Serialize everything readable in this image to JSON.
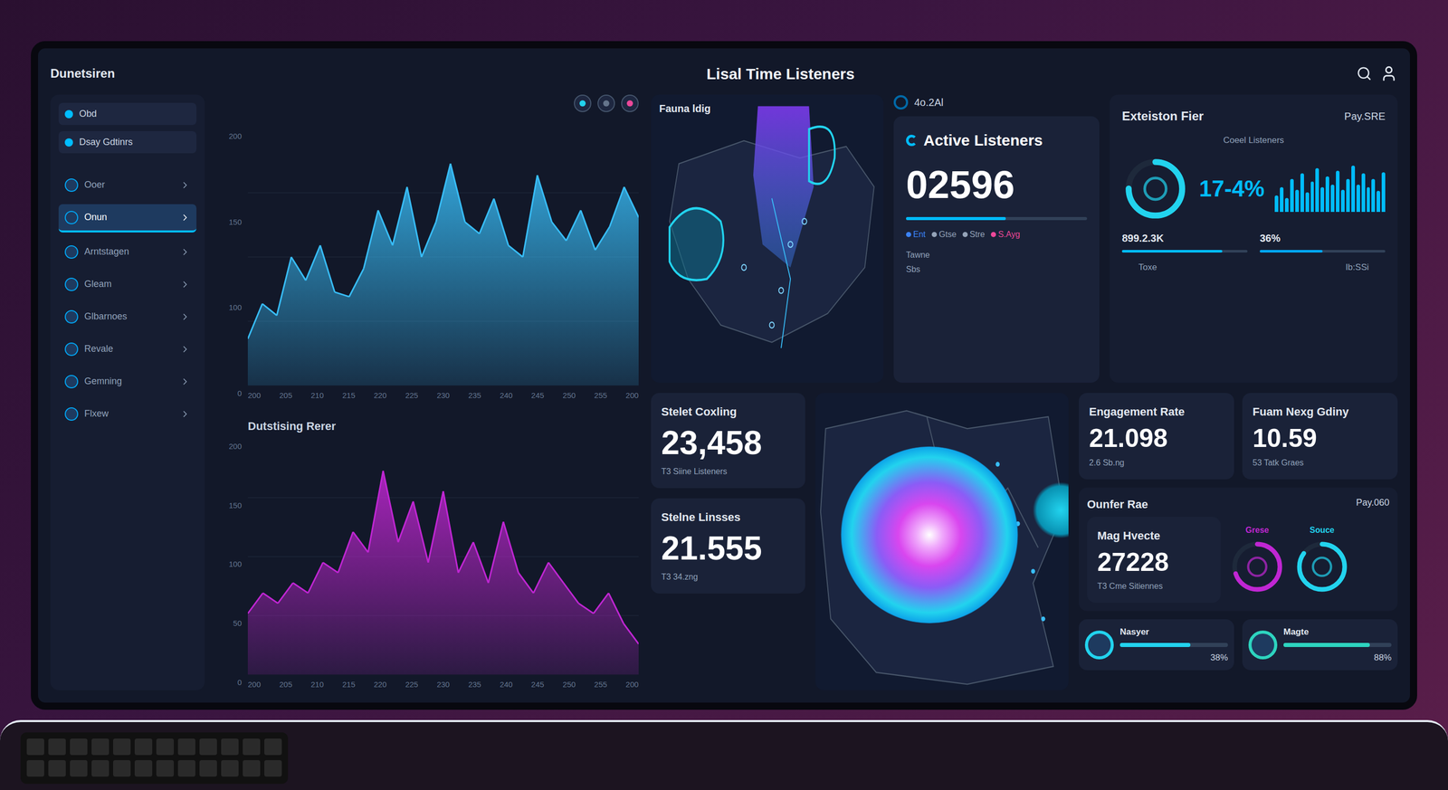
{
  "header": {
    "brand": "Dunetsiren",
    "title": "Lisal Time Listeners"
  },
  "sidebar": {
    "filters": [
      {
        "label": "Obd"
      },
      {
        "label": "Dsay Gdtinrs"
      }
    ],
    "items": [
      {
        "label": "Ooer",
        "selected": false
      },
      {
        "label": "Onun",
        "selected": true
      },
      {
        "label": "Arntstagen",
        "selected": false
      },
      {
        "label": "Gleam",
        "selected": false
      },
      {
        "label": "Glbarnoes",
        "selected": false
      },
      {
        "label": "Revale",
        "selected": false
      },
      {
        "label": "Gemning",
        "selected": false
      },
      {
        "label": "Flxew",
        "selected": false
      }
    ]
  },
  "charts": [
    {
      "title": "",
      "y_ticks": [
        "200",
        "150",
        "100",
        "0"
      ],
      "x_ticks": [
        "200",
        "205",
        "210",
        "215",
        "220",
        "225",
        "230",
        "235",
        "240",
        "245",
        "250",
        "255",
        "200"
      ],
      "values": [
        20,
        35,
        30,
        55,
        45,
        60,
        40,
        38,
        50,
        75,
        60,
        85,
        55,
        70,
        95,
        70,
        65,
        80,
        60,
        55,
        90,
        70,
        62,
        75,
        58,
        68,
        85,
        72
      ],
      "color": "#38bdf8"
    },
    {
      "title": "Dutstising Rerer",
      "y_ticks": [
        "200",
        "150",
        "100",
        "50",
        "0"
      ],
      "x_ticks": [
        "200",
        "205",
        "210",
        "215",
        "220",
        "225",
        "230",
        "235",
        "240",
        "245",
        "250",
        "255",
        "200"
      ],
      "values": [
        30,
        40,
        35,
        45,
        40,
        55,
        50,
        70,
        60,
        100,
        65,
        85,
        55,
        90,
        50,
        65,
        45,
        75,
        50,
        40,
        55,
        45,
        35,
        30,
        40,
        25,
        15
      ],
      "color": "#c026d3"
    }
  ],
  "map_top": {
    "label": "Fauna ldig"
  },
  "active": {
    "badge": "4o.2Al",
    "title": "Active Listeners",
    "value": "02596",
    "level": 0.55,
    "legend": [
      {
        "label": "Ent",
        "color": "#3b82f6"
      },
      {
        "label": "Gtse",
        "color": "#94a3b8"
      },
      {
        "label": "Stre",
        "color": "#94a3b8"
      },
      {
        "label": "S.Ayg",
        "color": "#ec4899"
      }
    ],
    "footer": [
      "Tawne",
      "Sbs"
    ]
  },
  "extension": {
    "title": "Exteiston Fier",
    "badge": "Pay.SRE",
    "subtitle": "Coeel Listeners",
    "percent": "17-4%",
    "ring_level": 0.75,
    "stat": "899.2.3K",
    "stat_level": 0.8,
    "stat2": "36%",
    "stat2_level": 0.5,
    "bars": [
      30,
      45,
      25,
      60,
      40,
      70,
      35,
      55,
      80,
      45,
      65,
      50,
      75,
      40,
      60,
      85,
      50,
      70,
      45,
      60,
      38,
      72
    ],
    "ticks": [
      "Toxe",
      "Ib:SSi"
    ]
  },
  "stat_cards": [
    {
      "title": "Stelet Coxling",
      "value": "23,458",
      "caption": "T3 Siine Listeners"
    },
    {
      "title": "Stelne Linsses",
      "value": "21.555",
      "caption": "T3 34.zng"
    }
  ],
  "kpis": [
    {
      "title": "Engagement Rate",
      "value": "21.098",
      "caption": "2.6 Sb.ng"
    },
    {
      "title": "Fuam Nexg Gdiny",
      "value": "10.59",
      "caption": "53 Tatk Graes"
    }
  ],
  "ouner": {
    "title": "Ounfer Rae",
    "badge": "Pay.060",
    "card": {
      "title": "Mag Hvecte",
      "value": "27228",
      "caption": "T3 Cme Sitiennes"
    },
    "rings": [
      {
        "label": "Grese",
        "level": 0.7,
        "color": "#c026d3"
      },
      {
        "label": "Souce",
        "level": 0.85,
        "color": "#22d3ee"
      }
    ]
  },
  "meters": [
    {
      "title": "Nasyer",
      "level": 0.65,
      "reading": "38%",
      "color": "#22d3ee"
    },
    {
      "title": "Magte",
      "level": 0.8,
      "reading": "88%",
      "color": "#2dd4bf"
    }
  ]
}
